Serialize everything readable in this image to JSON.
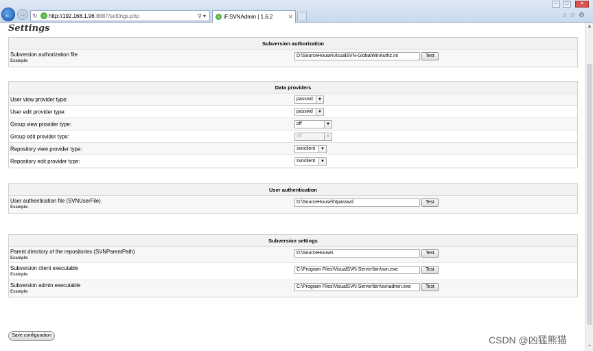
{
  "browser": {
    "url_host": "http://192.168.1.96",
    "url_rest": ":8887/settings.php",
    "tab_title": "iF.SVNAdmin | 1.6.2"
  },
  "page": {
    "title": "Settings",
    "save_label": "Save configuration",
    "watermark": "CSDN @凶猛熊猫"
  },
  "sections": {
    "auth": {
      "heading": "Subversion authorization",
      "label": "Subversion authorization file",
      "example": "Example:",
      "value": "D:\\SourceHouse\\VisualSVN-GlobalWinAuthz.ini",
      "test": "Test"
    },
    "providers": {
      "heading": "Data providers",
      "rows": [
        {
          "label": "User view provider type:",
          "value": "passwd"
        },
        {
          "label": "User edit provider type:",
          "value": "passwd"
        },
        {
          "label": "Group view provider type:",
          "value": "off"
        },
        {
          "label": "Group edit provider type:",
          "value": "off"
        },
        {
          "label": "Repository view provider type:",
          "value": "svnclient"
        },
        {
          "label": "Repository edit provider type:",
          "value": "svnclient"
        }
      ]
    },
    "userauth": {
      "heading": "User authentication",
      "label": "User authentication file (SVNUserFile)",
      "example": "Example:",
      "value": "D:\\SourceHouse\\htpasswd",
      "test": "Test"
    },
    "svn": {
      "heading": "Subversion settings",
      "rows": [
        {
          "label": "Parent directory of the repositories (SVNParentPath)",
          "example": "Example:",
          "value": "D:\\SourceHouse\\",
          "test": "Test"
        },
        {
          "label": "Subversion client executable",
          "example": "Example:",
          "value": "C:\\Program Files\\VisualSVN Server\\bin\\svn.exe",
          "test": "Test"
        },
        {
          "label": "Subversion admin executable",
          "example": "Example:",
          "value": "C:\\Program Files\\VisualSVN Server\\bin\\svnadmin.exe",
          "test": "Test"
        }
      ]
    }
  }
}
